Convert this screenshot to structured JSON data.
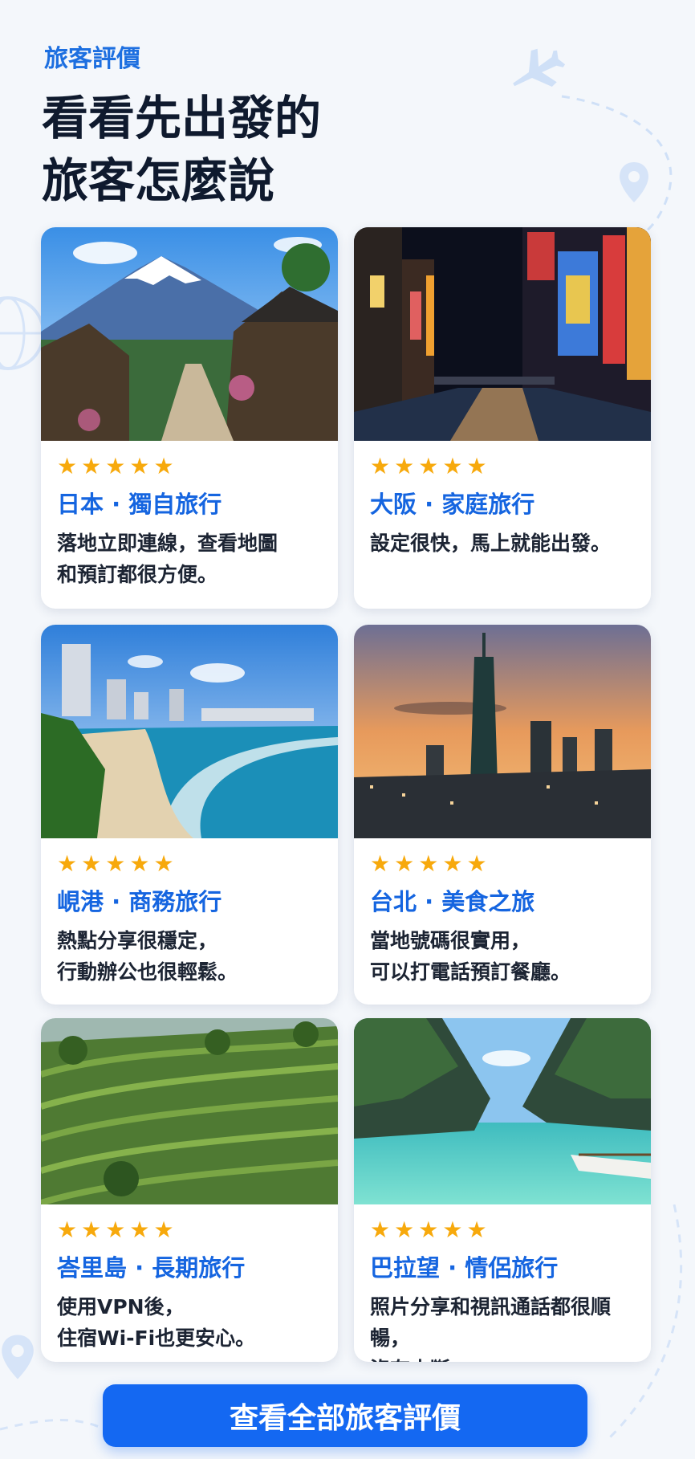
{
  "header": {
    "eyebrow": "旅客評價",
    "title_line1": "看看先出發的",
    "title_line2": "旅客怎麼說"
  },
  "reviews": [
    {
      "title": "日本 · 獨自旅行",
      "rating": 5,
      "text": [
        "落地立即連線，查看地圖",
        "和預訂都很方便。"
      ],
      "image": "mount-fuji-village"
    },
    {
      "title": "大阪 · 家庭旅行",
      "rating": 5,
      "text": [
        "設定很快，馬上就能出發。"
      ],
      "image": "osaka-canal-night"
    },
    {
      "title": "峴港 · 商務旅行",
      "rating": 5,
      "text": [
        "熱點分享很穩定，",
        "行動辦公也很輕鬆。"
      ],
      "image": "danang-beach"
    },
    {
      "title": "台北 · 美食之旅",
      "rating": 5,
      "text": [
        "當地號碼很實用，",
        "可以打電話預訂餐廳。"
      ],
      "image": "taipei-101-sunset"
    },
    {
      "title": "峇里島 · 長期旅行",
      "rating": 5,
      "text": [
        "使用VPN後，",
        "住宿Wi-Fi也更安心。"
      ],
      "image": "bali-rice-terraces"
    },
    {
      "title": "巴拉望 · 情侶旅行",
      "rating": 5,
      "text": [
        "照片分享和視訊通話都很順暢，",
        "沒有中斷。"
      ],
      "image": "palawan-lagoon"
    }
  ],
  "cta": {
    "label": "查看全部旅客評價"
  },
  "icons": {
    "star": "star-icon",
    "plane": "airplane-icon",
    "pin": "location-pin-icon",
    "globe": "globe-icon"
  },
  "colors": {
    "accent": "#1d6fe0",
    "star": "#f7a90c",
    "cta": "#1468f2"
  }
}
